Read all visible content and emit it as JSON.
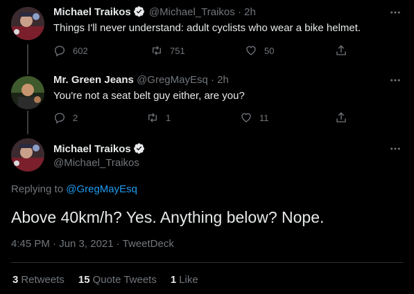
{
  "colors": {
    "background": "#000000",
    "accent": "#1d9bf0",
    "muted": "#71767b",
    "text": "#e7e9ea"
  },
  "tweet1": {
    "display_name": "Michael Traikos",
    "verified": true,
    "handle": "@Michael_Traikos",
    "dot": "·",
    "time": "2h",
    "text": "Things I'll never understand: adult cyclists who wear a bike helmet.",
    "replies": "602",
    "retweets": "751",
    "likes": "50",
    "icons": [
      "more-icon",
      "reply-icon",
      "retweet-icon",
      "like-icon",
      "share-icon"
    ]
  },
  "tweet2": {
    "display_name": "Mr. Green Jeans",
    "handle": "@GregMayEsq",
    "dot": "·",
    "time": "2h",
    "text": "You're not a seat belt guy either, are you?",
    "replies": "2",
    "retweets": "1",
    "likes": "11"
  },
  "main_tweet": {
    "display_name": "Michael Traikos",
    "verified": true,
    "handle": "@Michael_Traikos",
    "replying_prefix": "Replying to ",
    "replying_to": "@GregMayEsq",
    "text": "Above 40km/h? Yes. Anything below? Nope.",
    "meta": "4:45 PM · Jun 3, 2021 · TweetDeck",
    "stats": {
      "retweets_count": "3",
      "retweets_label": "Retweets",
      "quote_count": "15",
      "quote_label": "Quote Tweets",
      "likes_count": "1",
      "likes_label": "Like"
    }
  }
}
